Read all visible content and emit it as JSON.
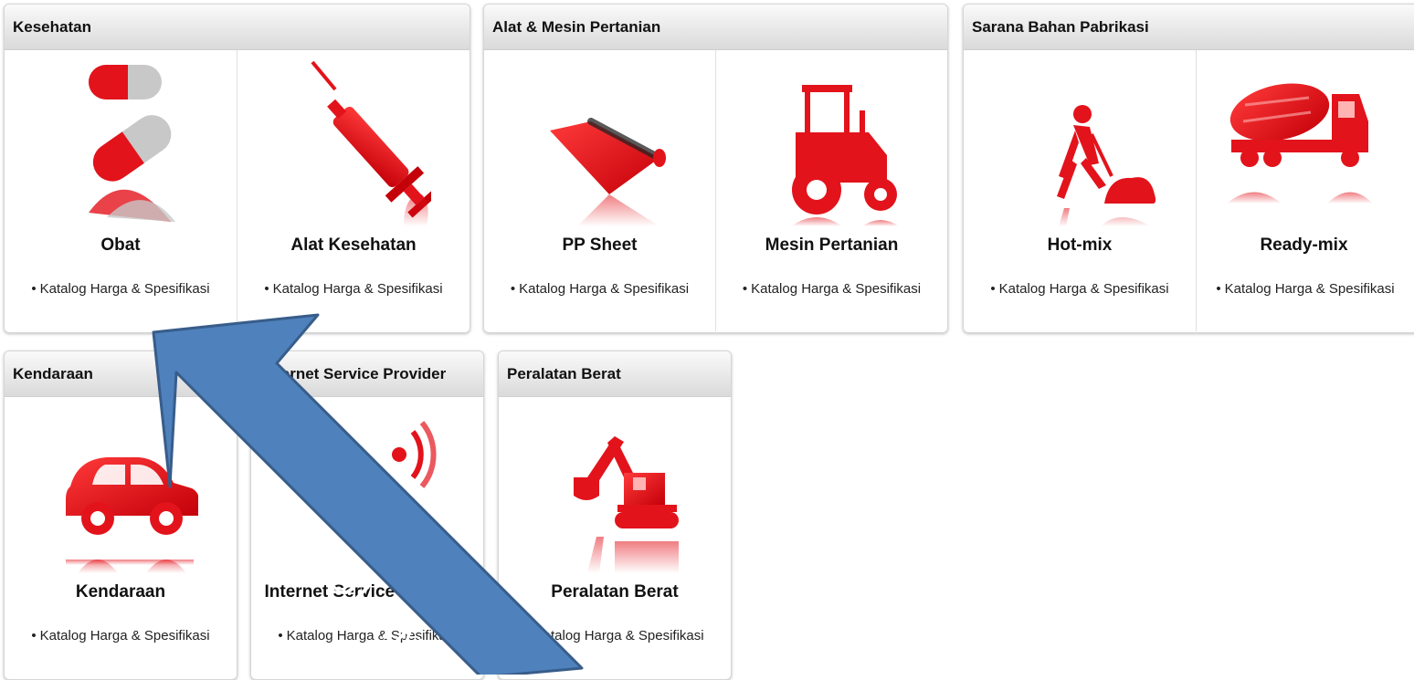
{
  "colors": {
    "icon_red": "#e3131b",
    "icon_grey": "#bcbcbc",
    "arrow_blue": "#4f81bd",
    "arrow_border": "#385d8a"
  },
  "panels": [
    {
      "title": "Kesehatan",
      "tiles": [
        {
          "name": "Obat",
          "link": "Katalog Harga & Spesifikasi",
          "icon": "pills-icon"
        },
        {
          "name": "Alat Kesehatan",
          "link": "Katalog Harga & Spesifikasi",
          "icon": "syringe-icon"
        }
      ]
    },
    {
      "title": "Alat & Mesin Pertanian",
      "tiles": [
        {
          "name": "PP Sheet",
          "link": "Katalog Harga & Spesifikasi",
          "icon": "sheet-roll-icon"
        },
        {
          "name": "Mesin Pertanian",
          "link": "Katalog Harga & Spesifikasi",
          "icon": "tractor-icon"
        }
      ]
    },
    {
      "title": "Sarana Bahan Pabrikasi",
      "tiles": [
        {
          "name": "Hot-mix",
          "link": "Katalog Harga & Spesifikasi",
          "icon": "road-worker-icon"
        },
        {
          "name": "Ready-mix",
          "link": "Katalog Harga & Spesifikasi",
          "icon": "concrete-mixer-truck-icon"
        }
      ]
    },
    {
      "title": "Kendaraan",
      "tiles": [
        {
          "name": "Kendaraan",
          "link": "Katalog Harga & Spesifikasi",
          "icon": "car-icon"
        }
      ]
    },
    {
      "title": "Internet Service Provider",
      "tiles": [
        {
          "name": "Internet Service Provider",
          "link": "Katalog Harga & Spesifikasi",
          "icon": "wifi-signal-icon"
        }
      ]
    },
    {
      "title": "Peralatan Berat",
      "tiles": [
        {
          "name": "Peralatan Berat",
          "link": "Katalog Harga & Spesifikasi",
          "icon": "excavator-icon"
        }
      ]
    }
  ],
  "bullet": "•",
  "overlay": {
    "arrow_text": "KLIK DI SINI"
  }
}
